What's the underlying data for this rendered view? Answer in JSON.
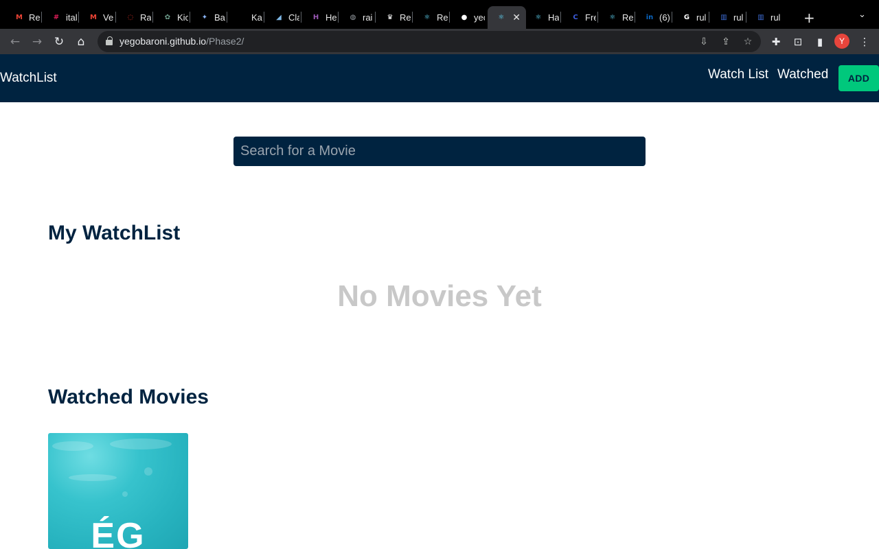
{
  "browser": {
    "tabs": [
      {
        "title": "Re",
        "icon": "gmail-icon",
        "color": "#ea4335",
        "glyph": "M"
      },
      {
        "title": "ital",
        "icon": "slack-icon",
        "color": "#e01e5a",
        "glyph": "#"
      },
      {
        "title": "Ve",
        "icon": "gmail-icon",
        "color": "#ea4335",
        "glyph": "M"
      },
      {
        "title": "Ra",
        "icon": "ring-icon",
        "color": "#d93025",
        "glyph": "◌"
      },
      {
        "title": "Kic",
        "icon": "chatgpt-icon",
        "color": "#6e9e8c",
        "glyph": "✿"
      },
      {
        "title": "Ba",
        "icon": "sparkle-icon",
        "color": "#8ab4f8",
        "glyph": "✦"
      },
      {
        "title": "Ka",
        "icon": "blank-icon",
        "color": "#000000",
        "glyph": ""
      },
      {
        "title": "Cla",
        "icon": "feather-icon",
        "color": "#7fb8e6",
        "glyph": "◢"
      },
      {
        "title": "He",
        "icon": "h-icon",
        "color": "#9b59b6",
        "glyph": "H"
      },
      {
        "title": "rai",
        "icon": "globe-icon",
        "color": "#9aa0a6",
        "glyph": "◍"
      },
      {
        "title": "Re",
        "icon": "crown-icon",
        "color": "#ffffff",
        "glyph": "♛"
      },
      {
        "title": "Re",
        "icon": "react-icon",
        "color": "#61dafb",
        "glyph": "⚛"
      },
      {
        "title": "yeç",
        "icon": "github-icon",
        "color": "#ffffff",
        "glyph": "●"
      },
      {
        "title": "",
        "icon": "react-icon",
        "color": "#61dafb",
        "glyph": "⚛",
        "active": true
      },
      {
        "title": "Ha",
        "icon": "react-icon",
        "color": "#61dafb",
        "glyph": "⚛"
      },
      {
        "title": "Fre",
        "icon": "c-icon",
        "color": "#3b5bdb",
        "glyph": "C"
      },
      {
        "title": "Re",
        "icon": "react-icon",
        "color": "#61dafb",
        "glyph": "⚛"
      },
      {
        "title": "(6)",
        "icon": "linkedin-icon",
        "color": "#0a66c2",
        "glyph": "in"
      },
      {
        "title": "rul",
        "icon": "google-icon",
        "color": "#ffffff",
        "glyph": "G"
      },
      {
        "title": "rul",
        "icon": "book-icon",
        "color": "#3f6fd8",
        "glyph": "▥"
      },
      {
        "title": "rul",
        "icon": "book-icon",
        "color": "#3f6fd8",
        "glyph": "▥"
      }
    ],
    "url_host": "yegobaroni.github.io",
    "url_path": "/Phase2/",
    "profile_initial": "Y"
  },
  "nav": {
    "brand": "WatchList",
    "links": [
      "Watch List",
      "Watched"
    ],
    "add_label": "ADD"
  },
  "search": {
    "placeholder": "Search for a Movie"
  },
  "watchlist": {
    "title": "My WatchList",
    "empty_text": "No Movies Yet"
  },
  "watched": {
    "title": "Watched Movies",
    "posters": [
      {
        "text": "ÉG"
      }
    ]
  },
  "colors": {
    "nav_bg": "#002340",
    "accent": "#00c87c",
    "empty_text": "#c8c8c8",
    "poster_water": "#27b3bf"
  }
}
